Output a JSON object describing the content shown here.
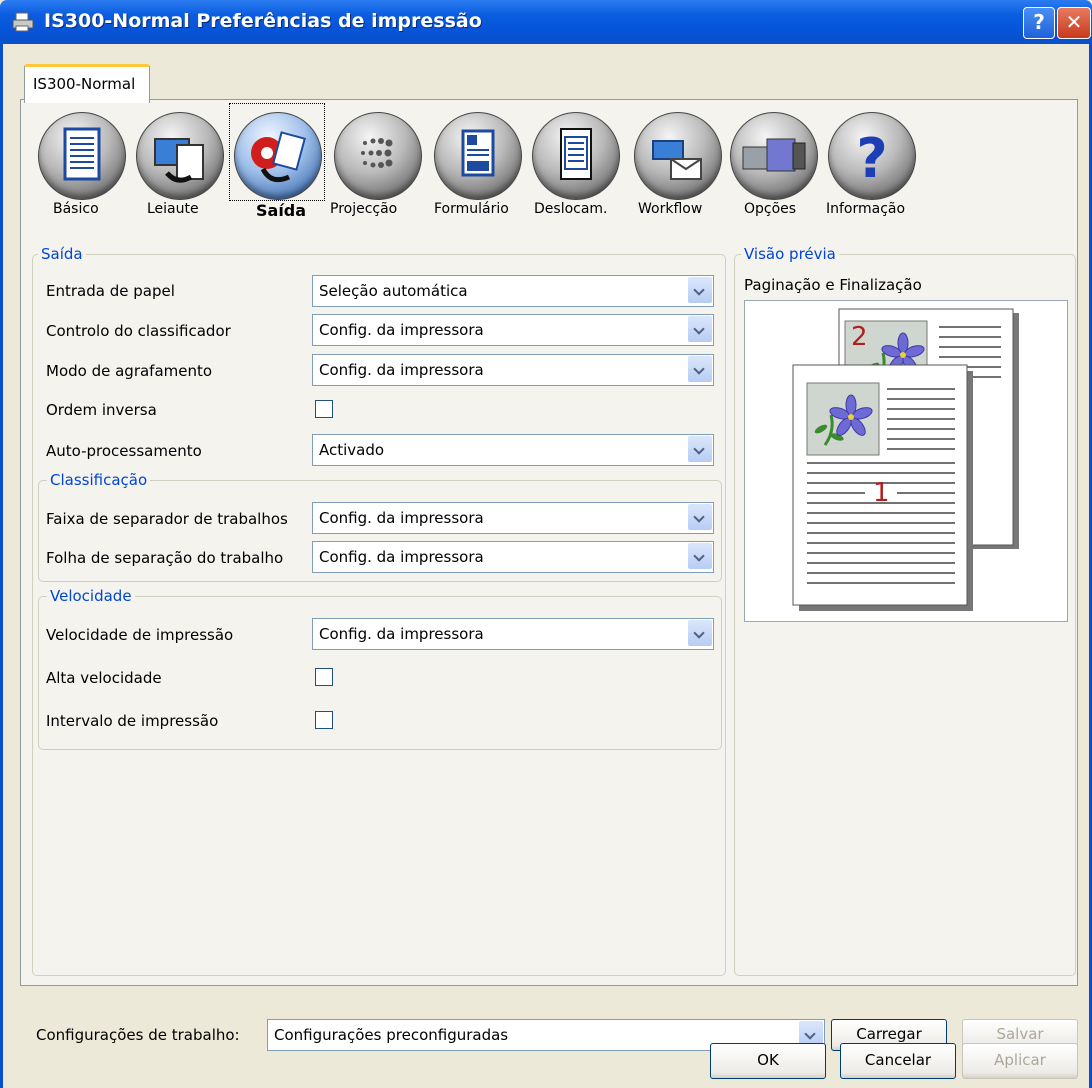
{
  "window": {
    "title": "IS300-Normal Preferências de impressão",
    "help_label": "?",
    "close_label": "✕"
  },
  "tab": {
    "label": "IS300-Normal"
  },
  "toolbar": [
    {
      "label": "Básico",
      "icon": "document-icon",
      "selected": false
    },
    {
      "label": "Leiaute",
      "icon": "monitor-layout-icon",
      "selected": false
    },
    {
      "label": "Saída",
      "icon": "output-icon",
      "selected": true
    },
    {
      "label": "Projecção",
      "icon": "halftone-icon",
      "selected": false
    },
    {
      "label": "Formulário",
      "icon": "form-icon",
      "selected": false
    },
    {
      "label": "Deslocam.",
      "icon": "shift-icon",
      "selected": false
    },
    {
      "label": "Workflow",
      "icon": "workflow-icon",
      "selected": false
    },
    {
      "label": "Opções",
      "icon": "options-icon",
      "selected": false
    },
    {
      "label": "Informação",
      "icon": "help-question-icon",
      "selected": false
    }
  ],
  "output": {
    "title": "Saída",
    "paper_input": {
      "label": "Entrada de papel",
      "value": "Seleção automática"
    },
    "sorter_control": {
      "label": "Controlo do classificador",
      "value": "Config. da impressora"
    },
    "staple_mode": {
      "label": "Modo de agrafamento",
      "value": "Config. da impressora"
    },
    "reverse_order": {
      "label": "Ordem inversa",
      "checked": false
    },
    "auto_process": {
      "label": "Auto-processamento",
      "value": "Activado"
    }
  },
  "sorting": {
    "title": "Classificação",
    "separator_band": {
      "label": "Faixa de separador de trabalhos",
      "value": "Config. da impressora"
    },
    "separator_sheet": {
      "label": "Folha de separação do trabalho",
      "value": "Config. da impressora"
    }
  },
  "speed": {
    "title": "Velocidade",
    "print_speed": {
      "label": "Velocidade de impressão",
      "value": "Config. da impressora"
    },
    "high_speed": {
      "label": "Alta velocidade",
      "checked": false
    },
    "print_interval": {
      "label": "Intervalo de impressão",
      "checked": false
    }
  },
  "preview": {
    "title": "Visão prévia",
    "caption": "Paginação e Finalização",
    "page_back_number": "2",
    "page_front_number": "1"
  },
  "job_settings": {
    "label": "Configurações de trabalho:",
    "value": "Configurações preconfiguradas",
    "load_label": "Carregar",
    "save_label": "Salvar"
  },
  "footer": {
    "ok_label": "OK",
    "cancel_label": "Cancelar",
    "apply_label": "Aplicar"
  }
}
